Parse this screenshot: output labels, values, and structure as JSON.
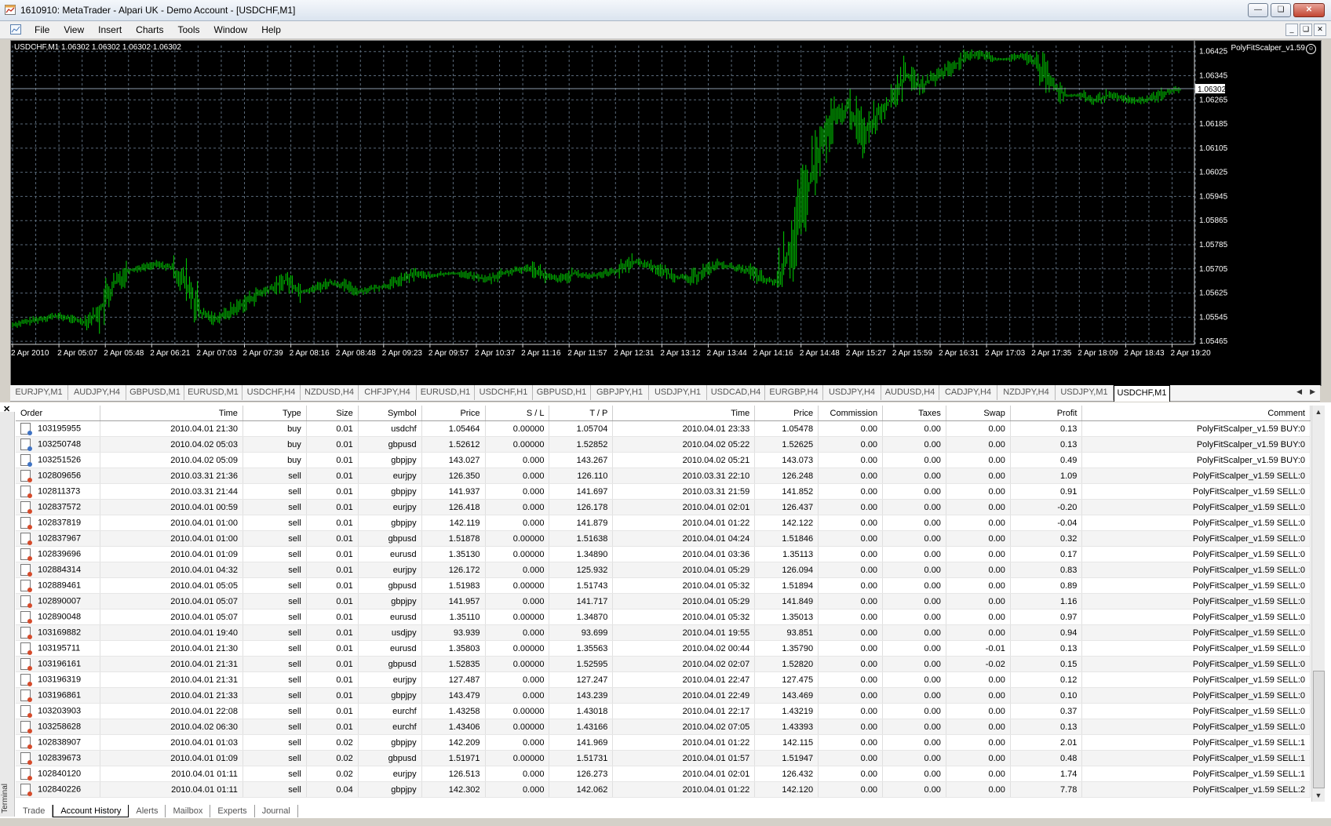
{
  "window": {
    "title": "1610910: MetaTrader - Alpari UK - Demo Account - [USDCHF,M1]"
  },
  "menu": [
    "File",
    "View",
    "Insert",
    "Charts",
    "Tools",
    "Window",
    "Help"
  ],
  "chart": {
    "header": "USDCHF,M1  1.06302 1.06302 1.06302 1.06302",
    "expert": "PolyFitScalper_v1.59",
    "current_price": "1.06302",
    "colors": {
      "background": "#000000",
      "candle": "#00c000",
      "grid": "#5a6a7a",
      "axis_text": "#ffffff"
    }
  },
  "chart_data": {
    "type": "line",
    "title": "USDCHF,M1",
    "xlabel": "",
    "ylabel": "",
    "x_ticks": [
      "2 Apr 2010",
      "2 Apr 05:07",
      "2 Apr 05:48",
      "2 Apr 06:21",
      "2 Apr 07:03",
      "2 Apr 07:39",
      "2 Apr 08:16",
      "2 Apr 08:48",
      "2 Apr 09:23",
      "2 Apr 09:57",
      "2 Apr 10:37",
      "2 Apr 11:16",
      "2 Apr 11:57",
      "2 Apr 12:31",
      "2 Apr 13:12",
      "2 Apr 13:44",
      "2 Apr 14:16",
      "2 Apr 14:48",
      "2 Apr 15:27",
      "2 Apr 15:59",
      "2 Apr 16:31",
      "2 Apr 17:03",
      "2 Apr 17:35",
      "2 Apr 18:09",
      "2 Apr 18:43",
      "2 Apr 19:20"
    ],
    "y_ticks": [
      "1.06425",
      "1.06345",
      "1.06265",
      "1.06185",
      "1.06105",
      "1.06025",
      "1.05945",
      "1.05865",
      "1.05785",
      "1.05705",
      "1.05625",
      "1.05545",
      "1.05465"
    ],
    "ylim": [
      1.05455,
      1.06445
    ],
    "price_line": 1.06302,
    "series": [
      {
        "values": [
          1.0552,
          1.0553,
          1.0554,
          1.0555,
          1.0554,
          1.0553,
          1.0556,
          1.0565,
          1.057,
          1.0571,
          1.0572,
          1.0571,
          1.0566,
          1.0556,
          1.0554,
          1.0556,
          1.0559,
          1.0562,
          1.0564,
          1.0567,
          1.0563,
          1.0564,
          1.0566,
          1.0565,
          1.0563,
          1.0564,
          1.0565,
          1.0567,
          1.0569,
          1.0568,
          1.0569,
          1.0569,
          1.0568,
          1.0567,
          1.0569,
          1.057,
          1.0571,
          1.0568,
          1.0567,
          1.0569,
          1.0568,
          1.0569,
          1.057,
          1.0573,
          1.0572,
          1.057,
          1.0568,
          1.0567,
          1.057,
          1.0572,
          1.0571,
          1.057,
          1.0567,
          1.0566,
          1.0578,
          1.0594,
          1.061,
          1.062,
          1.0624,
          1.0615,
          1.0622,
          1.0627,
          1.0635,
          1.0631,
          1.0634,
          1.0637,
          1.064,
          1.0642,
          1.064,
          1.064,
          1.0641,
          1.0639,
          1.0632,
          1.0628,
          1.0628,
          1.0626,
          1.0628,
          1.0627,
          1.0626,
          1.0627,
          1.0629,
          1.063
        ]
      }
    ]
  },
  "chart_tabs": [
    "EURJPY,M1",
    "AUDJPY,H4",
    "GBPUSD,M1",
    "EURUSD,M1",
    "USDCHF,H4",
    "NZDUSD,H4",
    "CHFJPY,H4",
    "EURUSD,H1",
    "USDCHF,H1",
    "GBPUSD,H1",
    "GBPJPY,H1",
    "USDJPY,H1",
    "USDCAD,H4",
    "EURGBP,H4",
    "USDJPY,H4",
    "AUDUSD,H4",
    "CADJPY,H4",
    "NZDJPY,H4",
    "USDJPY,M1",
    "USDCHF,M1"
  ],
  "terminal": {
    "side_label": "Terminal",
    "columns": [
      "Order",
      "Time",
      "Type",
      "Size",
      "Symbol",
      "Price",
      "S / L",
      "T / P",
      "Time",
      "Price",
      "Commission",
      "Taxes",
      "Swap",
      "Profit",
      "Comment"
    ],
    "sort_indicator": "/",
    "rows": [
      [
        "103195955",
        "2010.04.01 21:30",
        "buy",
        "0.01",
        "usdchf",
        "1.05464",
        "0.00000",
        "1.05704",
        "2010.04.01 23:33",
        "1.05478",
        "0.00",
        "0.00",
        "0.00",
        "0.13",
        "PolyFitScalper_v1.59 BUY:0"
      ],
      [
        "103250748",
        "2010.04.02 05:03",
        "buy",
        "0.01",
        "gbpusd",
        "1.52612",
        "0.00000",
        "1.52852",
        "2010.04.02 05:22",
        "1.52625",
        "0.00",
        "0.00",
        "0.00",
        "0.13",
        "PolyFitScalper_v1.59 BUY:0"
      ],
      [
        "103251526",
        "2010.04.02 05:09",
        "buy",
        "0.01",
        "gbpjpy",
        "143.027",
        "0.000",
        "143.267",
        "2010.04.02 05:21",
        "143.073",
        "0.00",
        "0.00",
        "0.00",
        "0.49",
        "PolyFitScalper_v1.59 BUY:0"
      ],
      [
        "102809656",
        "2010.03.31 21:36",
        "sell",
        "0.01",
        "eurjpy",
        "126.350",
        "0.000",
        "126.110",
        "2010.03.31 22:10",
        "126.248",
        "0.00",
        "0.00",
        "0.00",
        "1.09",
        "PolyFitScalper_v1.59 SELL:0"
      ],
      [
        "102811373",
        "2010.03.31 21:44",
        "sell",
        "0.01",
        "gbpjpy",
        "141.937",
        "0.000",
        "141.697",
        "2010.03.31 21:59",
        "141.852",
        "0.00",
        "0.00",
        "0.00",
        "0.91",
        "PolyFitScalper_v1.59 SELL:0"
      ],
      [
        "102837572",
        "2010.04.01 00:59",
        "sell",
        "0.01",
        "eurjpy",
        "126.418",
        "0.000",
        "126.178",
        "2010.04.01 02:01",
        "126.437",
        "0.00",
        "0.00",
        "0.00",
        "-0.20",
        "PolyFitScalper_v1.59 SELL:0"
      ],
      [
        "102837819",
        "2010.04.01 01:00",
        "sell",
        "0.01",
        "gbpjpy",
        "142.119",
        "0.000",
        "141.879",
        "2010.04.01 01:22",
        "142.122",
        "0.00",
        "0.00",
        "0.00",
        "-0.04",
        "PolyFitScalper_v1.59 SELL:0"
      ],
      [
        "102837967",
        "2010.04.01 01:00",
        "sell",
        "0.01",
        "gbpusd",
        "1.51878",
        "0.00000",
        "1.51638",
        "2010.04.01 04:24",
        "1.51846",
        "0.00",
        "0.00",
        "0.00",
        "0.32",
        "PolyFitScalper_v1.59 SELL:0"
      ],
      [
        "102839696",
        "2010.04.01 01:09",
        "sell",
        "0.01",
        "eurusd",
        "1.35130",
        "0.00000",
        "1.34890",
        "2010.04.01 03:36",
        "1.35113",
        "0.00",
        "0.00",
        "0.00",
        "0.17",
        "PolyFitScalper_v1.59 SELL:0"
      ],
      [
        "102884314",
        "2010.04.01 04:32",
        "sell",
        "0.01",
        "eurjpy",
        "126.172",
        "0.000",
        "125.932",
        "2010.04.01 05:29",
        "126.094",
        "0.00",
        "0.00",
        "0.00",
        "0.83",
        "PolyFitScalper_v1.59 SELL:0"
      ],
      [
        "102889461",
        "2010.04.01 05:05",
        "sell",
        "0.01",
        "gbpusd",
        "1.51983",
        "0.00000",
        "1.51743",
        "2010.04.01 05:32",
        "1.51894",
        "0.00",
        "0.00",
        "0.00",
        "0.89",
        "PolyFitScalper_v1.59 SELL:0"
      ],
      [
        "102890007",
        "2010.04.01 05:07",
        "sell",
        "0.01",
        "gbpjpy",
        "141.957",
        "0.000",
        "141.717",
        "2010.04.01 05:29",
        "141.849",
        "0.00",
        "0.00",
        "0.00",
        "1.16",
        "PolyFitScalper_v1.59 SELL:0"
      ],
      [
        "102890048",
        "2010.04.01 05:07",
        "sell",
        "0.01",
        "eurusd",
        "1.35110",
        "0.00000",
        "1.34870",
        "2010.04.01 05:32",
        "1.35013",
        "0.00",
        "0.00",
        "0.00",
        "0.97",
        "PolyFitScalper_v1.59 SELL:0"
      ],
      [
        "103169882",
        "2010.04.01 19:40",
        "sell",
        "0.01",
        "usdjpy",
        "93.939",
        "0.000",
        "93.699",
        "2010.04.01 19:55",
        "93.851",
        "0.00",
        "0.00",
        "0.00",
        "0.94",
        "PolyFitScalper_v1.59 SELL:0"
      ],
      [
        "103195711",
        "2010.04.01 21:30",
        "sell",
        "0.01",
        "eurusd",
        "1.35803",
        "0.00000",
        "1.35563",
        "2010.04.02 00:44",
        "1.35790",
        "0.00",
        "0.00",
        "-0.01",
        "0.13",
        "PolyFitScalper_v1.59 SELL:0"
      ],
      [
        "103196161",
        "2010.04.01 21:31",
        "sell",
        "0.01",
        "gbpusd",
        "1.52835",
        "0.00000",
        "1.52595",
        "2010.04.02 02:07",
        "1.52820",
        "0.00",
        "0.00",
        "-0.02",
        "0.15",
        "PolyFitScalper_v1.59 SELL:0"
      ],
      [
        "103196319",
        "2010.04.01 21:31",
        "sell",
        "0.01",
        "eurjpy",
        "127.487",
        "0.000",
        "127.247",
        "2010.04.01 22:47",
        "127.475",
        "0.00",
        "0.00",
        "0.00",
        "0.12",
        "PolyFitScalper_v1.59 SELL:0"
      ],
      [
        "103196861",
        "2010.04.01 21:33",
        "sell",
        "0.01",
        "gbpjpy",
        "143.479",
        "0.000",
        "143.239",
        "2010.04.01 22:49",
        "143.469",
        "0.00",
        "0.00",
        "0.00",
        "0.10",
        "PolyFitScalper_v1.59 SELL:0"
      ],
      [
        "103203903",
        "2010.04.01 22:08",
        "sell",
        "0.01",
        "eurchf",
        "1.43258",
        "0.00000",
        "1.43018",
        "2010.04.01 22:17",
        "1.43219",
        "0.00",
        "0.00",
        "0.00",
        "0.37",
        "PolyFitScalper_v1.59 SELL:0"
      ],
      [
        "103258628",
        "2010.04.02 06:30",
        "sell",
        "0.01",
        "eurchf",
        "1.43406",
        "0.00000",
        "1.43166",
        "2010.04.02 07:05",
        "1.43393",
        "0.00",
        "0.00",
        "0.00",
        "0.13",
        "PolyFitScalper_v1.59 SELL:0"
      ],
      [
        "102838907",
        "2010.04.01 01:03",
        "sell",
        "0.02",
        "gbpjpy",
        "142.209",
        "0.000",
        "141.969",
        "2010.04.01 01:22",
        "142.115",
        "0.00",
        "0.00",
        "0.00",
        "2.01",
        "PolyFitScalper_v1.59 SELL:1"
      ],
      [
        "102839673",
        "2010.04.01 01:09",
        "sell",
        "0.02",
        "gbpusd",
        "1.51971",
        "0.00000",
        "1.51731",
        "2010.04.01 01:57",
        "1.51947",
        "0.00",
        "0.00",
        "0.00",
        "0.48",
        "PolyFitScalper_v1.59 SELL:1"
      ],
      [
        "102840120",
        "2010.04.01 01:11",
        "sell",
        "0.02",
        "eurjpy",
        "126.513",
        "0.000",
        "126.273",
        "2010.04.01 02:01",
        "126.432",
        "0.00",
        "0.00",
        "0.00",
        "1.74",
        "PolyFitScalper_v1.59 SELL:1"
      ],
      [
        "102840226",
        "2010.04.01 01:11",
        "sell",
        "0.04",
        "gbpjpy",
        "142.302",
        "0.000",
        "142.062",
        "2010.04.01 01:22",
        "142.120",
        "0.00",
        "0.00",
        "0.00",
        "7.78",
        "PolyFitScalper_v1.59 SELL:2"
      ]
    ],
    "tabs": [
      "Trade",
      "Account History",
      "Alerts",
      "Mailbox",
      "Experts",
      "Journal"
    ],
    "active_tab": "Account History"
  }
}
